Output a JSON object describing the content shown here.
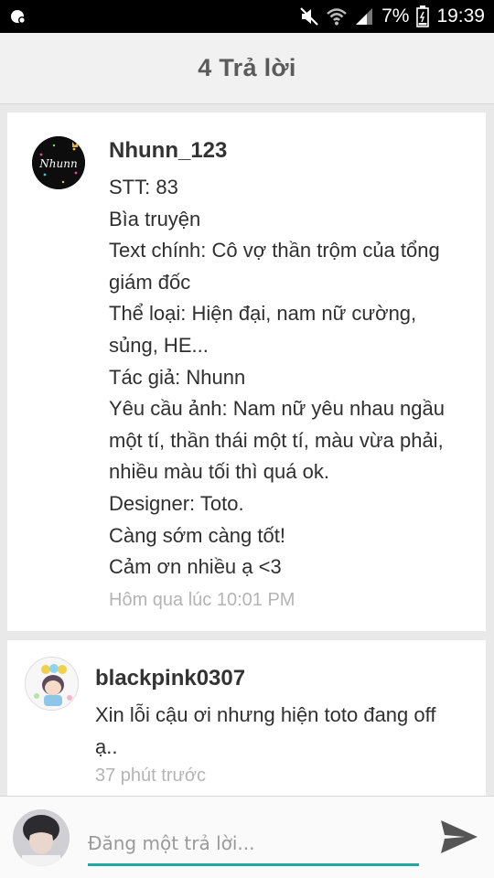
{
  "status_bar": {
    "battery": "7%",
    "time": "19:39"
  },
  "header": {
    "title": "4 Trả lời"
  },
  "replies": [
    {
      "username": "Nhunn_123",
      "avatar_text": "Nhunn",
      "lines": [
        "STT: 83",
        "Bìa truyện",
        "Text chính: Cô vợ thần trộm của tổng",
        "giám đốc",
        "Thể loại: Hiện đại, nam nữ cường,",
        "sủng, HE...",
        "Tác giả: Nhunn",
        "Yêu cầu ảnh: Nam nữ yêu nhau ngầu",
        "một tí, thần thái một tí, màu vừa phải,",
        "nhiều màu tối thì quá ok.",
        "Designer: Toto.",
        "Càng sớm càng tốt!",
        "Cảm ơn nhiều ạ <3"
      ],
      "time": "Hôm qua lúc 10:01 PM"
    },
    {
      "username": "blackpink0307",
      "lines": [
        "Xin lỗi cậu ơi nhưng hiện toto đang off",
        "ạ.."
      ],
      "time": "37 phút trước"
    }
  ],
  "composer": {
    "placeholder": "Đăng một trả lời...",
    "value": ""
  },
  "icons": {
    "status_left": "notification-icon",
    "mute": "mute-icon",
    "wifi": "wifi-icon",
    "signal": "signal-icon",
    "battery": "battery-icon",
    "send": "send-icon"
  },
  "colors": {
    "accent": "#1fa8a0",
    "header_bg": "#f1f1f1",
    "page_bg": "#e9e9e9"
  }
}
